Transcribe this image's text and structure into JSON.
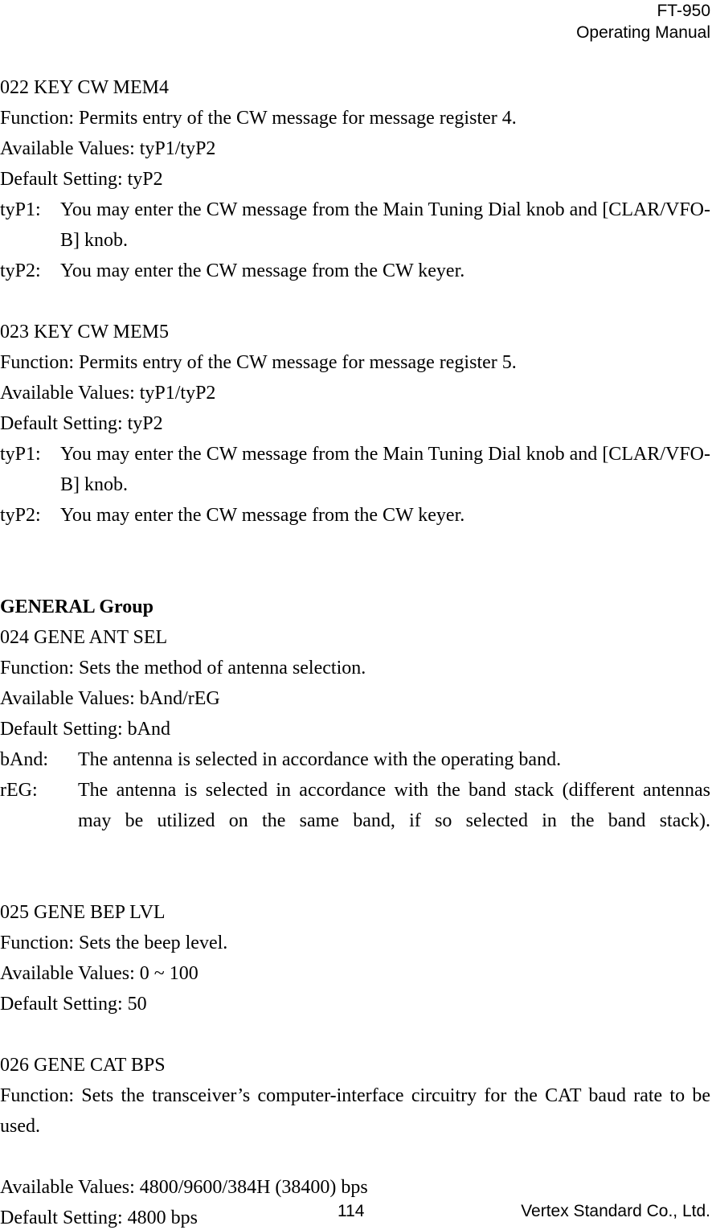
{
  "header": {
    "line1": "FT-950",
    "line2": "Operating Manual"
  },
  "menu_items": [
    {
      "title": "022 KEY CW MEM4",
      "function": "Function: Permits entry of the CW message for message register 4.",
      "available_values": "Available Values: tyP1/tyP2",
      "default_setting": "Default Setting: tyP2",
      "definitions": [
        {
          "term": "tyP1:",
          "description": "You may enter the CW message from the Main Tuning Dial knob and [CLAR/VFO-B] knob."
        },
        {
          "term": "tyP2:",
          "description": "You may enter the CW message from the CW keyer."
        }
      ]
    },
    {
      "title": "023 KEY CW MEM5",
      "function": "Function: Permits entry of the CW message for message register 5.",
      "available_values": "Available Values: tyP1/tyP2",
      "default_setting": "Default Setting: tyP2",
      "definitions": [
        {
          "term": "tyP1:",
          "description": "You may enter the CW message from the Main Tuning Dial knob and [CLAR/VFO-B] knob."
        },
        {
          "term": "tyP2:",
          "description": "You may enter the CW message from the CW keyer."
        }
      ]
    }
  ],
  "group_heading": "GENERAL Group",
  "general_items": [
    {
      "title": "024 GENE ANT SEL",
      "function": "Function: Sets the method of antenna selection.",
      "available_values": "Available Values: bAnd/rEG",
      "default_setting": "Default Setting: bAnd",
      "definitions": [
        {
          "term": "bAnd:",
          "description": "The antenna is selected in accordance with the operating band."
        },
        {
          "term": "rEG:",
          "description": "The antenna is selected in accordance with the band stack (different antennas may be utilized on the same band, if so selected in the band stack)."
        }
      ]
    },
    {
      "title": "025 GENE BEP LVL",
      "function": "Function: Sets the beep level.",
      "available_values": "Available Values: 0 ~ 100",
      "default_setting": "Default Setting: 50"
    },
    {
      "title": "026 GENE CAT BPS",
      "function": "Function: Sets the transceiver’s computer-interface circuitry for the CAT baud rate to be used.",
      "available_values": "Available Values: 4800/9600/384H (38400) bps",
      "default_setting": "Default Setting: 4800 bps"
    }
  ],
  "footer": {
    "page_number": "114",
    "publisher": "Vertex Standard Co., Ltd."
  }
}
